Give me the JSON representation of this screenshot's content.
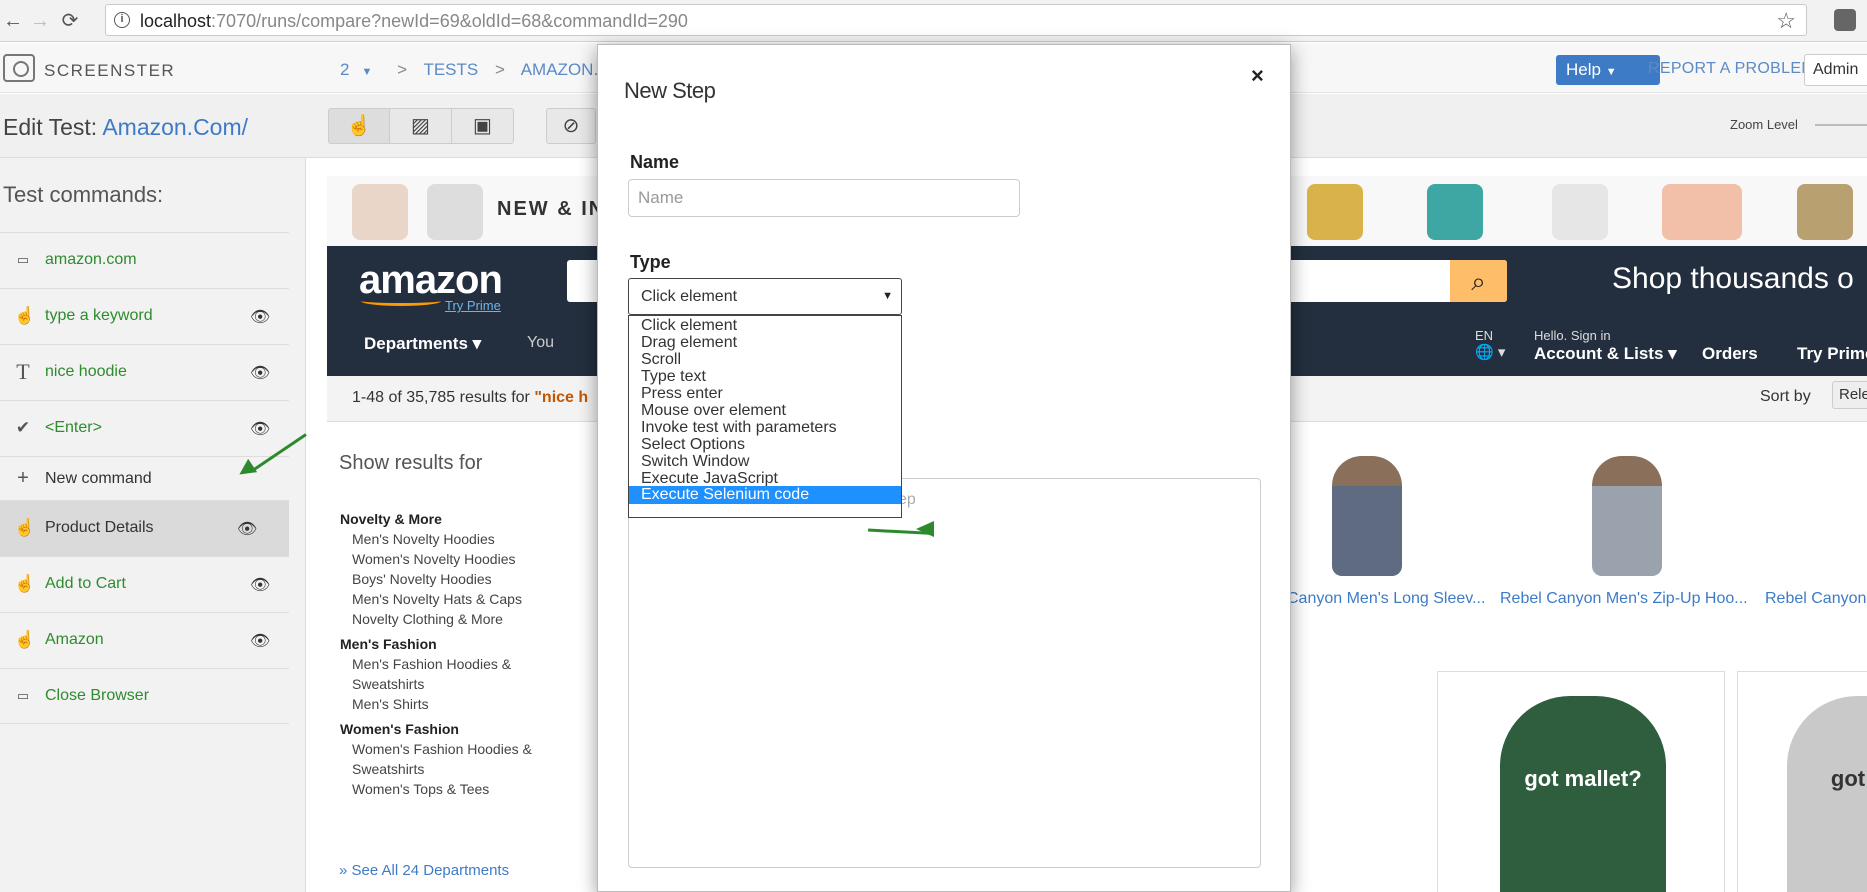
{
  "browser": {
    "url_host": "localhost",
    "url_rest": ":7070/runs/compare?newId=69&oldId=68&commandId=290"
  },
  "app": {
    "brand": "SCREENSTER",
    "breadcrumb": [
      "2",
      ">",
      "TESTS",
      ">",
      "AMAZON.COM/"
    ],
    "help_label": "Help",
    "report_label": "REPORT A PROBLEM",
    "user_label": "Admin",
    "edit_label": "Edit Test:",
    "test_title": "Amazon.Com/",
    "zoom_label": "Zoom Level"
  },
  "sidebar": {
    "title": "Test commands:",
    "commands": [
      {
        "label": "amazon.com",
        "icon": "browser-icon",
        "eye": false
      },
      {
        "label": "type a keyword",
        "icon": "pointer-icon",
        "eye": true
      },
      {
        "label": "nice hoodie",
        "icon": "text-icon",
        "eye": true
      },
      {
        "label": "<Enter>",
        "icon": "check-icon",
        "eye": true
      },
      {
        "label": "New command",
        "icon": "plus-icon",
        "eye": false
      },
      {
        "label": "Product Details",
        "icon": "pointer-icon",
        "eye": true,
        "selected": true
      },
      {
        "label": "Add to Cart",
        "icon": "pointer-icon",
        "eye": true
      },
      {
        "label": "Amazon",
        "icon": "pointer-icon",
        "eye": true
      },
      {
        "label": "Close Browser",
        "icon": "browser-icon",
        "eye": false
      }
    ]
  },
  "preview": {
    "promo": "NEW & IN",
    "logo": "amazon",
    "try_prime": "Try Prime",
    "shop_text": "Shop thousands o",
    "departments": "Departments ▾",
    "you": "You",
    "lang": "EN",
    "hello": "Hello. Sign in",
    "account": "Account & Lists ▾",
    "orders": "Orders",
    "try_prime_nav": "Try Prime",
    "results_prefix": "1-48 of 35,785 results for ",
    "results_query": "\"nice h",
    "sort_by": "Sort by",
    "sort_value": "Releva",
    "show_results": "Show results for",
    "filters": [
      {
        "head": "Novelty & More",
        "items": [
          "Men's Novelty Hoodies",
          "Women's Novelty Hoodies",
          "Boys' Novelty Hoodies",
          "Men's Novelty Hats & Caps",
          "Novelty Clothing & More"
        ]
      },
      {
        "head": "Men's Fashion",
        "items": [
          "Men's Fashion Hoodies &",
          "Sweatshirts",
          "Men's Shirts"
        ]
      },
      {
        "head": "Women's Fashion",
        "items": [
          "Women's Fashion Hoodies &",
          "Sweatshirts",
          "Women's Tops & Tees"
        ]
      }
    ],
    "see_all": "See All 24 Departments",
    "products": [
      "Canyon Men's Long Sleev...",
      "Rebel Canyon Men's Zip-Up Hoo...",
      "Rebel Canyon"
    ],
    "hoodie_1": "got mallet?",
    "hoodie_2": "got jet l"
  },
  "modal": {
    "title": "New Step",
    "close": "×",
    "name_label": "Name",
    "name_placeholder": "Name",
    "name_value": "",
    "type_label": "Type",
    "type_selected": "Click element",
    "textarea_placeholder": "ep",
    "options": [
      "Click element",
      "Drag element",
      "Scroll",
      "Type text",
      "Press enter",
      "Mouse over element",
      "Invoke test with parameters",
      "Select Options",
      "Switch Window",
      "Execute JavaScript",
      "Execute Selenium code"
    ],
    "highlighted_option": "Execute Selenium code"
  },
  "colors": {
    "accent": "#3e7bc7",
    "command_green": "#2e8b2e",
    "annotation_arrow": "#2c8a2c",
    "option_highlight": "#1e90ff",
    "amazon_nav": "#232f3e"
  }
}
